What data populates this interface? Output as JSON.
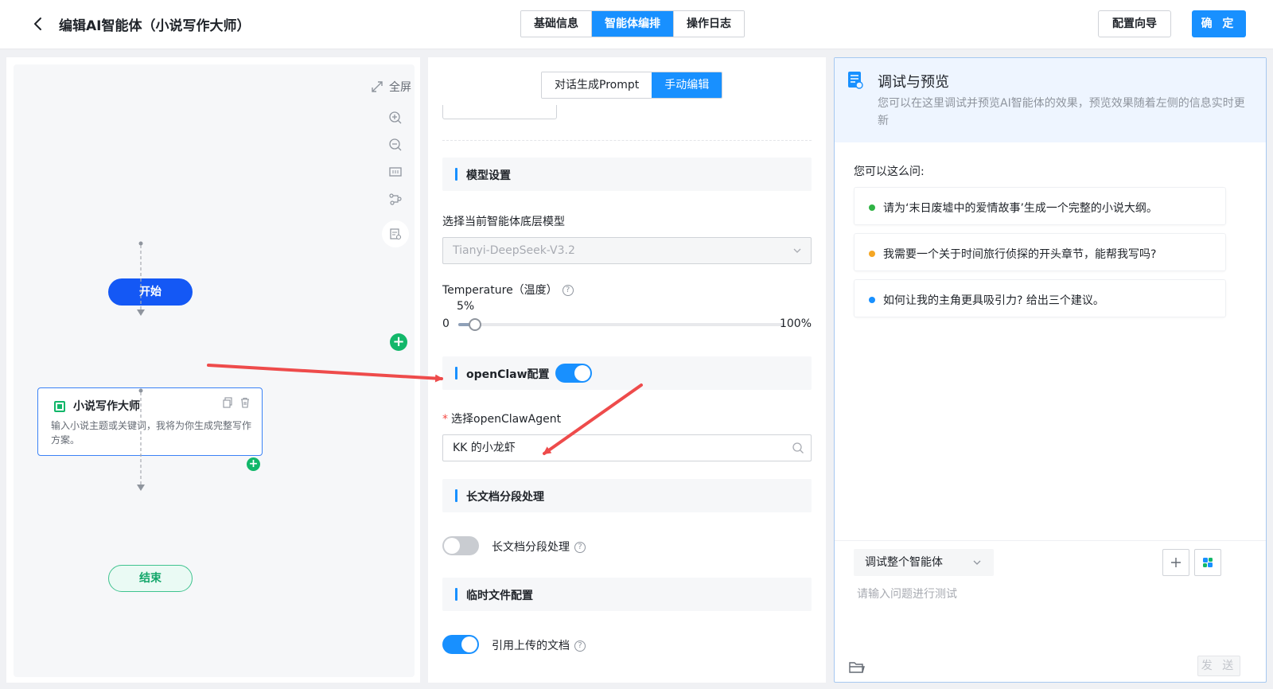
{
  "header": {
    "title": "编辑AI智能体（小说写作大师）",
    "tabs": [
      "基础信息",
      "智能体编排",
      "操作日志"
    ],
    "active_tab": "智能体编排",
    "guide_label": "配置向导",
    "confirm_label": "确 定"
  },
  "flow": {
    "fullscreen_label": "全屏",
    "start_label": "开始",
    "end_label": "结束",
    "agent_node": {
      "title": "小说写作大师",
      "desc": "输入小说主题或关键词，我将为你生成完整写作方案。"
    }
  },
  "config": {
    "mode_tabs": [
      "对话生成Prompt",
      "手动编辑"
    ],
    "active_mode": "手动编辑",
    "model_section": "模型设置",
    "model_label": "选择当前智能体底层模型",
    "model_value": "Tianyi-DeepSeek-V3.2",
    "temperature_label": "Temperature（温度）",
    "temperature_value": "5%",
    "temperature_fraction": 0.05,
    "temperature_min": "0",
    "temperature_max": "100%",
    "openclaw_section": "openClaw配置",
    "openclaw_enabled": true,
    "openclaw_agent_label": "选择openClawAgent",
    "openclaw_agent_value": "KK 的小龙虾",
    "longdoc_section": "长文档分段处理",
    "longdoc_label": "长文档分段处理",
    "longdoc_enabled": false,
    "tempfile_section": "临时文件配置",
    "tempfile_label": "引用上传的文档",
    "tempfile_enabled": true
  },
  "preview": {
    "title": "调试与预览",
    "desc": "您可以在这里调试并预览AI智能体的效果，预览效果随着左侧的信息实时更新",
    "ask_label": "您可以这么问:",
    "suggestions": [
      {
        "text": "请为‘末日废墟中的爱情故事’生成一个完整的小说大纲。",
        "color": "#2fb344"
      },
      {
        "text": "我需要一个关于时间旅行侦探的开头章节，能帮我写吗?",
        "color": "#f5a623"
      },
      {
        "text": "如何让我的主角更具吸引力? 给出三个建议。",
        "color": "#1890ff"
      }
    ],
    "mode_value": "调试整个智能体",
    "input_placeholder": "请输入问题进行测试",
    "send_label": "发 送"
  },
  "colors": {
    "primary": "#1890ff",
    "start_node": "#1458f5",
    "green": "#12b76a",
    "arrow": "#ee4b4b"
  }
}
